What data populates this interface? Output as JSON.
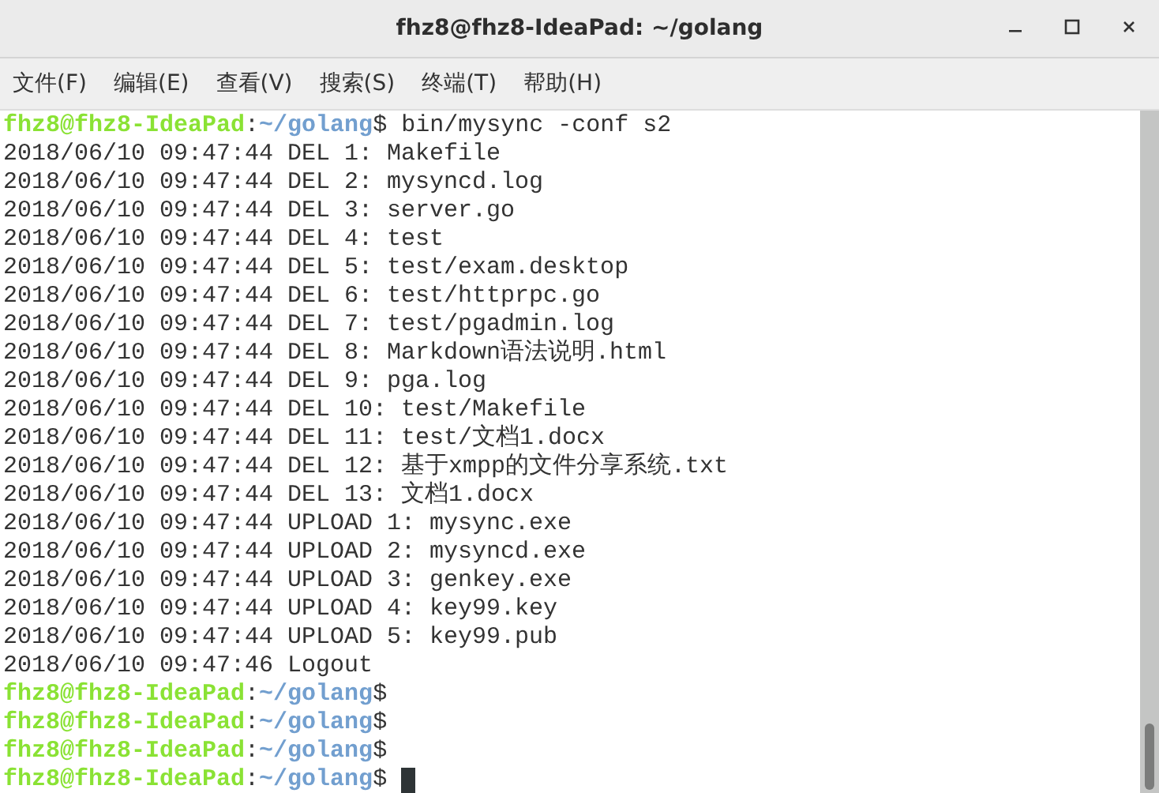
{
  "window": {
    "title": "fhz8@fhz8-IdeaPad: ~/golang"
  },
  "menu": [
    "文件(F)",
    "编辑(E)",
    "查看(V)",
    "搜索(S)",
    "终端(T)",
    "帮助(H)"
  ],
  "terminal": {
    "lines": [
      {
        "kind": "prompt",
        "user_host": "fhz8@fhz8-IdeaPad",
        "separator": ":",
        "path": "~/golang",
        "sign": "$",
        "command": "bin/mysync -conf s2",
        "cursor": false
      },
      {
        "kind": "output",
        "text": "2018/06/10 09:47:44 DEL 1: Makefile"
      },
      {
        "kind": "output",
        "text": "2018/06/10 09:47:44 DEL 2: mysyncd.log"
      },
      {
        "kind": "output",
        "text": "2018/06/10 09:47:44 DEL 3: server.go"
      },
      {
        "kind": "output",
        "text": "2018/06/10 09:47:44 DEL 4: test"
      },
      {
        "kind": "output",
        "text": "2018/06/10 09:47:44 DEL 5: test/exam.desktop"
      },
      {
        "kind": "output",
        "text": "2018/06/10 09:47:44 DEL 6: test/httprpc.go"
      },
      {
        "kind": "output",
        "text": "2018/06/10 09:47:44 DEL 7: test/pgadmin.log"
      },
      {
        "kind": "output",
        "text": "2018/06/10 09:47:44 DEL 8: Markdown语法说明.html"
      },
      {
        "kind": "output",
        "text": "2018/06/10 09:47:44 DEL 9: pga.log"
      },
      {
        "kind": "output",
        "text": "2018/06/10 09:47:44 DEL 10: test/Makefile"
      },
      {
        "kind": "output",
        "text": "2018/06/10 09:47:44 DEL 11: test/文档1.docx"
      },
      {
        "kind": "output",
        "text": "2018/06/10 09:47:44 DEL 12: 基于xmpp的文件分享系统.txt"
      },
      {
        "kind": "output",
        "text": "2018/06/10 09:47:44 DEL 13: 文档1.docx"
      },
      {
        "kind": "output",
        "text": "2018/06/10 09:47:44 UPLOAD 1: mysync.exe"
      },
      {
        "kind": "output",
        "text": "2018/06/10 09:47:44 UPLOAD 2: mysyncd.exe"
      },
      {
        "kind": "output",
        "text": "2018/06/10 09:47:44 UPLOAD 3: genkey.exe"
      },
      {
        "kind": "output",
        "text": "2018/06/10 09:47:44 UPLOAD 4: key99.key"
      },
      {
        "kind": "output",
        "text": "2018/06/10 09:47:44 UPLOAD 5: key99.pub"
      },
      {
        "kind": "output",
        "text": "2018/06/10 09:47:46 Logout"
      },
      {
        "kind": "prompt",
        "user_host": "fhz8@fhz8-IdeaPad",
        "separator": ":",
        "path": "~/golang",
        "sign": "$",
        "cursor": false
      },
      {
        "kind": "prompt",
        "user_host": "fhz8@fhz8-IdeaPad",
        "separator": ":",
        "path": "~/golang",
        "sign": "$",
        "cursor": false
      },
      {
        "kind": "prompt",
        "user_host": "fhz8@fhz8-IdeaPad",
        "separator": ":",
        "path": "~/golang",
        "sign": "$",
        "cursor": false
      },
      {
        "kind": "prompt",
        "user_host": "fhz8@fhz8-IdeaPad",
        "separator": ":",
        "path": "~/golang",
        "sign": "$",
        "cursor": true
      }
    ]
  }
}
